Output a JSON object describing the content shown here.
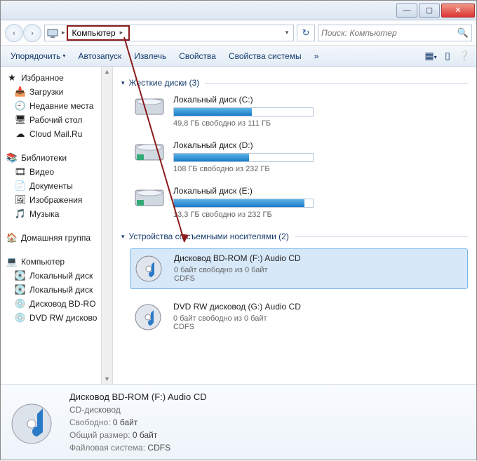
{
  "titlebar": {
    "min": "—",
    "max": "▢",
    "close": "✕"
  },
  "nav": {
    "back": "‹",
    "fwd": "›"
  },
  "breadcrumb": {
    "root_sep": "▸",
    "label": "Компьютер",
    "sep": "▸"
  },
  "search": {
    "placeholder": "Поиск: Компьютер"
  },
  "toolbar": {
    "organize": "Упорядочить",
    "autorun": "Автозапуск",
    "eject": "Извлечь",
    "properties": "Свойства",
    "sysprops": "Свойства системы",
    "more": "»"
  },
  "sidebar": {
    "favorites": {
      "head": "Избранное",
      "items": [
        "Загрузки",
        "Недавние места",
        "Рабочий стол",
        "Cloud Mail.Ru"
      ]
    },
    "libraries": {
      "head": "Библиотеки",
      "items": [
        "Видео",
        "Документы",
        "Изображения",
        "Музыка"
      ]
    },
    "homegroup": "Домашняя группа",
    "computer": {
      "head": "Компьютер",
      "items": [
        "Локальный диск",
        "Локальный диск",
        "Дисковод BD-RO",
        "DVD RW дисково"
      ]
    }
  },
  "sections": {
    "hdd_title": "Жесткие диски (3)",
    "removable_title": "Устройства со съемными носителями (2)"
  },
  "drives": [
    {
      "name": "Локальный диск (C:)",
      "sub": "49,8 ГБ свободно из 111 ГБ",
      "fill": 56
    },
    {
      "name": "Локальный диск (D:)",
      "sub": "108 ГБ свободно из 232 ГБ",
      "fill": 54
    },
    {
      "name": "Локальный диск (E:)",
      "sub": "13,3 ГБ свободно из 232 ГБ",
      "fill": 94
    }
  ],
  "removable": [
    {
      "name": "Дисковод BD-ROM (F:) Audio CD",
      "sub1": "0 байт свободно из 0 байт",
      "sub2": "CDFS"
    },
    {
      "name": "DVD RW дисковод (G:) Audio CD",
      "sub1": "0 байт свободно из 0 байт",
      "sub2": "CDFS"
    }
  ],
  "details": {
    "title": "Дисковод BD-ROM (F:) Audio CD",
    "type": "CD-дисковод",
    "free_k": "Свободно:",
    "free_v": "0 байт",
    "size_k": "Общий размер:",
    "size_v": "0 байт",
    "fs_k": "Файловая система:",
    "fs_v": "CDFS"
  }
}
